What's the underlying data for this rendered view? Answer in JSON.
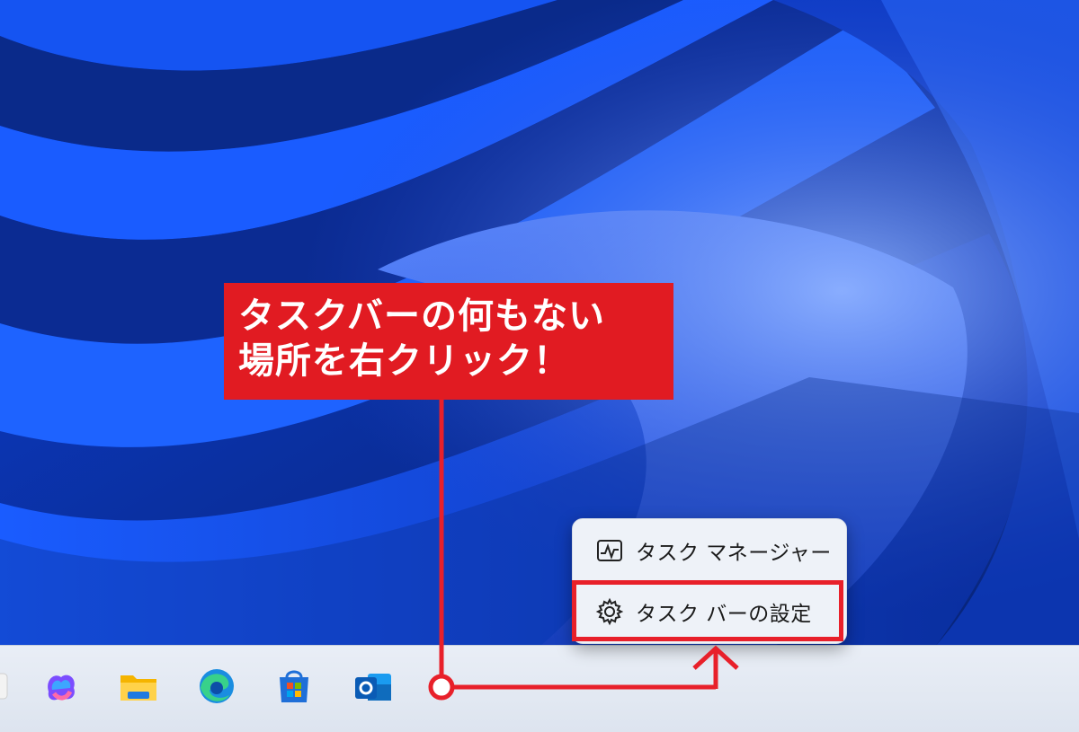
{
  "callout": {
    "line1": "タスクバーの何もない",
    "line2": "場所を右クリック！"
  },
  "context_menu": {
    "items": [
      {
        "label": "タスク マネージャー",
        "icon": "task-manager-icon"
      },
      {
        "label": "タスク バーの設定",
        "icon": "gear-icon"
      }
    ]
  },
  "taskbar": {
    "icons": [
      "copilot-icon",
      "file-explorer-icon",
      "edge-icon",
      "microsoft-store-icon",
      "outlook-icon"
    ]
  },
  "colors": {
    "annotation_red": "#e11b22",
    "menu_bg": "#eef2f8",
    "taskbar_bg": "#e4e9f2",
    "wallpaper_blue": "#0a2a8a"
  }
}
